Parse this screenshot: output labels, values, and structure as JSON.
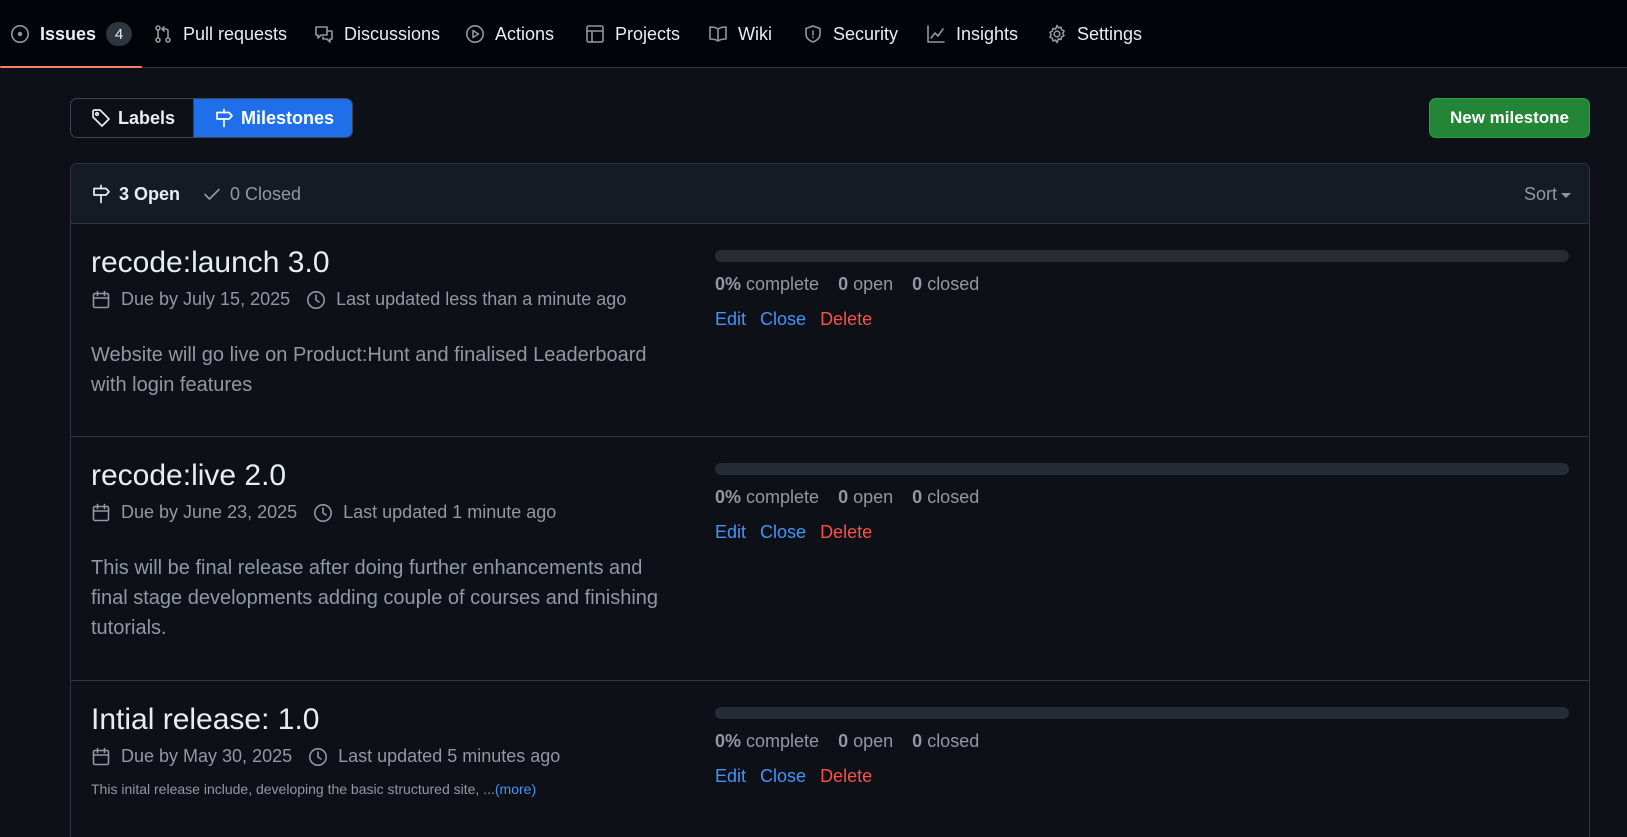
{
  "nav": {
    "tabs": [
      {
        "label": "Issues",
        "count": "4",
        "icon": "issue-opened-icon",
        "active": true
      },
      {
        "label": "Pull requests",
        "icon": "git-pull-request-icon"
      },
      {
        "label": "Discussions",
        "icon": "comment-discussion-icon"
      },
      {
        "label": "Actions",
        "icon": "play-icon"
      },
      {
        "label": "Projects",
        "icon": "table-icon"
      },
      {
        "label": "Wiki",
        "icon": "book-icon"
      },
      {
        "label": "Security",
        "icon": "shield-icon"
      },
      {
        "label": "Insights",
        "icon": "graph-icon"
      },
      {
        "label": "Settings",
        "icon": "gear-icon"
      }
    ]
  },
  "subnav": {
    "labels": "Labels",
    "milestones": "Milestones",
    "selected": "Milestones"
  },
  "new_milestone": "New milestone",
  "states": {
    "open": "3 Open",
    "closed": "0 Closed"
  },
  "sort": "Sort",
  "milestones": [
    {
      "title": "recode:launch 3.0",
      "due": "Due by July 15, 2025",
      "updated": "Last updated less than a minute ago",
      "description": "Website will go live on Product:Hunt and finalised Leaderboard with login features",
      "progress": 0,
      "complete_pct": "0%",
      "complete_label": "complete",
      "open_count": "0",
      "open_label": "open",
      "closed_count": "0",
      "closed_label": "closed"
    },
    {
      "title": "recode:live 2.0",
      "due": "Due by June 23, 2025",
      "updated": "Last updated 1 minute ago",
      "description": "This will be final release after doing further enhancements and final stage developments adding couple of courses and finishing tutorials.",
      "progress": 0,
      "complete_pct": "0%",
      "complete_label": "complete",
      "open_count": "0",
      "open_label": "open",
      "closed_count": "0",
      "closed_label": "closed"
    },
    {
      "title": "Intial release: 1.0",
      "due": "Due by May 30, 2025",
      "updated": "Last updated 5 minutes ago",
      "description": "This inital release include, developing the basic structured site, ...",
      "more": "(more)",
      "progress": 0,
      "complete_pct": "0%",
      "complete_label": "complete",
      "open_count": "0",
      "open_label": "open",
      "closed_count": "0",
      "closed_label": "closed"
    }
  ],
  "row_actions": {
    "edit": "Edit",
    "close": "Close",
    "delete": "Delete"
  },
  "colors": {
    "background": "#0d1117",
    "accent_blue": "#1f6feb",
    "link_blue": "#4493f8",
    "primary_green": "#238636",
    "danger_red": "#f85149",
    "active_underline": "#f78166"
  }
}
